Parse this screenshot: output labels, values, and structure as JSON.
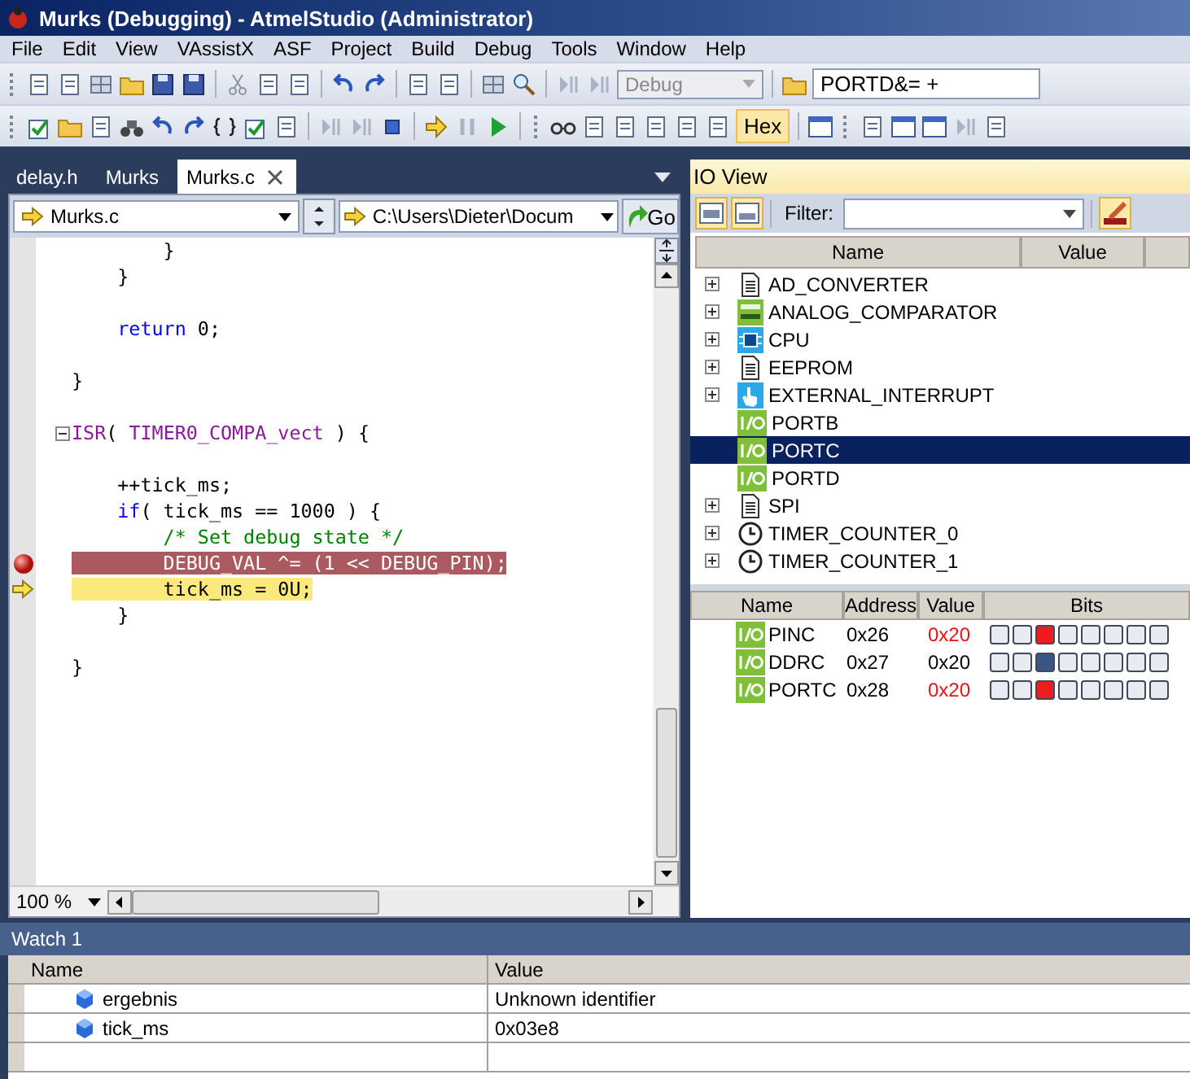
{
  "window": {
    "title": "Murks (Debugging) - AtmelStudio (Administrator)"
  },
  "menu": [
    "File",
    "Edit",
    "View",
    "VAssistX",
    "ASF",
    "Project",
    "Build",
    "Debug",
    "Tools",
    "Window",
    "Help"
  ],
  "toolbar": {
    "configuration": "Debug",
    "command": "PORTD&= +",
    "hex": {
      "label": "Hex",
      "on": true
    }
  },
  "tabs": [
    {
      "label": "delay.h",
      "selected": false
    },
    {
      "label": "Murks",
      "selected": false
    },
    {
      "label": "Murks.c",
      "selected": true
    }
  ],
  "editor": {
    "file": "Murks.c",
    "path": "C:\\Users\\Dieter\\Docum",
    "go": "Go",
    "zoom": "100 %",
    "lines": [
      {
        "kind": "code",
        "breakpoint": false,
        "current": false,
        "segments": [
          {
            "text": "        }",
            "kind": "plain"
          }
        ]
      },
      {
        "kind": "code",
        "breakpoint": false,
        "current": false,
        "segments": [
          {
            "text": "    }",
            "kind": "plain"
          }
        ]
      },
      {
        "kind": "blank"
      },
      {
        "kind": "code",
        "breakpoint": false,
        "current": false,
        "segments": [
          {
            "text": "    return",
            "kind": "keyword"
          },
          {
            "text": " 0;",
            "kind": "plain"
          }
        ]
      },
      {
        "kind": "blank"
      },
      {
        "kind": "code",
        "breakpoint": false,
        "current": false,
        "segments": [
          {
            "text": "}",
            "kind": "plain"
          }
        ]
      },
      {
        "kind": "blank"
      },
      {
        "kind": "code",
        "breakpoint": false,
        "current": false,
        "expanded": true,
        "segments": [
          {
            "text": "ISR",
            "kind": "macro"
          },
          {
            "text": "( ",
            "kind": "plain"
          },
          {
            "text": "TIMER0_COMPA_vect",
            "kind": "macro"
          },
          {
            "text": " ) {",
            "kind": "plain"
          }
        ]
      },
      {
        "kind": "blank"
      },
      {
        "kind": "code",
        "breakpoint": false,
        "current": false,
        "segments": [
          {
            "text": "    ++tick_ms;",
            "kind": "plain"
          }
        ]
      },
      {
        "kind": "code",
        "breakpoint": false,
        "current": false,
        "segments": [
          {
            "text": "    if",
            "kind": "keyword"
          },
          {
            "text": "( tick_ms == 1000 ) {",
            "kind": "plain"
          }
        ]
      },
      {
        "kind": "code",
        "breakpoint": false,
        "current": false,
        "segments": [
          {
            "text": "        /* Set debug state */",
            "kind": "comment"
          }
        ]
      },
      {
        "kind": "code",
        "breakpoint": true,
        "current": false,
        "segments": [
          {
            "text": "        DEBUG_VAL ^= (1 << DEBUG_PIN);",
            "kind": "plain"
          }
        ]
      },
      {
        "kind": "code",
        "breakpoint": false,
        "current": true,
        "segments": [
          {
            "text": "        tick_ms = 0U;",
            "kind": "plain"
          }
        ]
      },
      {
        "kind": "code",
        "breakpoint": false,
        "current": false,
        "segments": [
          {
            "text": "    }",
            "kind": "plain"
          }
        ]
      },
      {
        "kind": "blank"
      },
      {
        "kind": "code",
        "breakpoint": false,
        "current": false,
        "segments": [
          {
            "text": "}",
            "kind": "plain"
          }
        ]
      }
    ]
  },
  "io_view": {
    "title": "IO View",
    "filter_label": "Filter:",
    "columns": [
      "Name",
      "Value"
    ],
    "modules": [
      {
        "name": "AD_CONVERTER",
        "kind": "doc",
        "expandable": true,
        "selected": false
      },
      {
        "name": "ANALOG_COMPARATOR",
        "kind": "adc",
        "expandable": true,
        "selected": false
      },
      {
        "name": "CPU",
        "kind": "chip",
        "expandable": true,
        "selected": false
      },
      {
        "name": "EEPROM",
        "kind": "doc",
        "expandable": true,
        "selected": false
      },
      {
        "name": "EXTERNAL_INTERRUPT",
        "kind": "hand",
        "expandable": true,
        "selected": false
      },
      {
        "name": "PORTB",
        "kind": "io",
        "expandable": false,
        "selected": false
      },
      {
        "name": "PORTC",
        "kind": "io",
        "expandable": false,
        "selected": true
      },
      {
        "name": "PORTD",
        "kind": "io",
        "expandable": false,
        "selected": false
      },
      {
        "name": "SPI",
        "kind": "doc",
        "expandable": true,
        "selected": false
      },
      {
        "name": "TIMER_COUNTER_0",
        "kind": "clock",
        "expandable": true,
        "selected": false
      },
      {
        "name": "TIMER_COUNTER_1",
        "kind": "clock",
        "expandable": true,
        "selected": false
      }
    ],
    "register_columns": [
      "Name",
      "Address",
      "Value",
      "Bits"
    ],
    "registers": [
      {
        "name": "PINC",
        "address": "0x26",
        "value": "0x20",
        "changed": true,
        "bits": [
          false,
          false,
          true,
          false,
          false,
          false,
          false,
          false
        ]
      },
      {
        "name": "DDRC",
        "address": "0x27",
        "value": "0x20",
        "changed": false,
        "bits": [
          false,
          false,
          true,
          false,
          false,
          false,
          false,
          false
        ]
      },
      {
        "name": "PORTC",
        "address": "0x28",
        "value": "0x20",
        "changed": true,
        "bits": [
          false,
          false,
          true,
          false,
          false,
          false,
          false,
          false
        ]
      }
    ]
  },
  "watch": {
    "title": "Watch 1",
    "columns": [
      "Name",
      "Value"
    ],
    "rows": [
      {
        "name": "ergebnis",
        "value": "Unknown identifier"
      },
      {
        "name": "tick_ms",
        "value": "0x03e8"
      }
    ]
  }
}
